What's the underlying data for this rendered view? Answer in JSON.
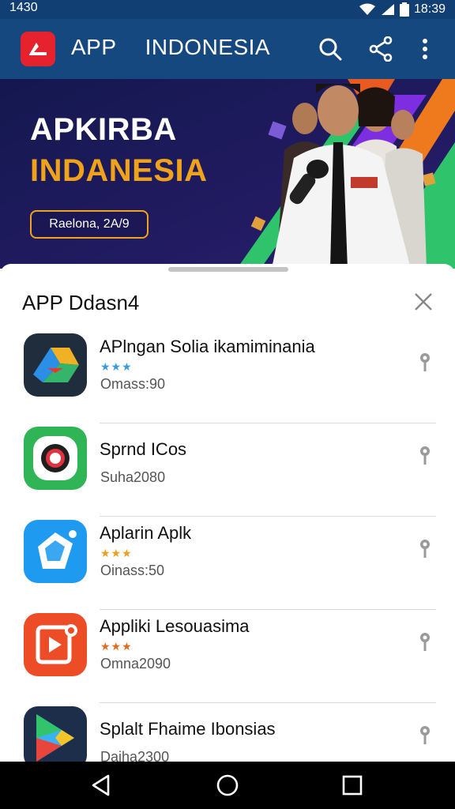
{
  "status_bar": {
    "time_left": "1430",
    "time_right": "18:39"
  },
  "app_bar": {
    "title": "APP  INDONESIA"
  },
  "banner": {
    "title_line1": "APKIRBA",
    "title_line2": "INDANESIA",
    "pill": "Raelona, 2A/9"
  },
  "sheet": {
    "title": "APP Ddasn4"
  },
  "apps": [
    {
      "name": "APlngan Solia ikamiminania",
      "stars": "★★★",
      "star_color": "#3a9be0",
      "sub": "Omass:90"
    },
    {
      "name": "Sprnd ICos",
      "stars": "",
      "star_color": "",
      "sub": "Suha2080"
    },
    {
      "name": "Aplarin Aplk",
      "stars": "★★★",
      "star_color": "#e9a020",
      "sub": "Oinass:50"
    },
    {
      "name": "Appliki Lesouasima",
      "stars": "★★★",
      "star_color": "#e36a1d",
      "sub": "Omna2090"
    },
    {
      "name": "Splalt Fhaime Ibonsias",
      "stars": "",
      "star_color": "",
      "sub": "Daiha2300"
    }
  ],
  "icons": {
    "logo": "app-logo-icon",
    "search": "search-icon",
    "share": "share-icon",
    "more": "more-vert-icon",
    "close": "close-icon",
    "pin": "pin-icon",
    "back": "back-icon",
    "home": "home-icon",
    "recents": "recents-icon"
  },
  "colors": {
    "app_bar": "#15487f",
    "accent": "#f1a21b",
    "brand_red": "#e5222d"
  }
}
